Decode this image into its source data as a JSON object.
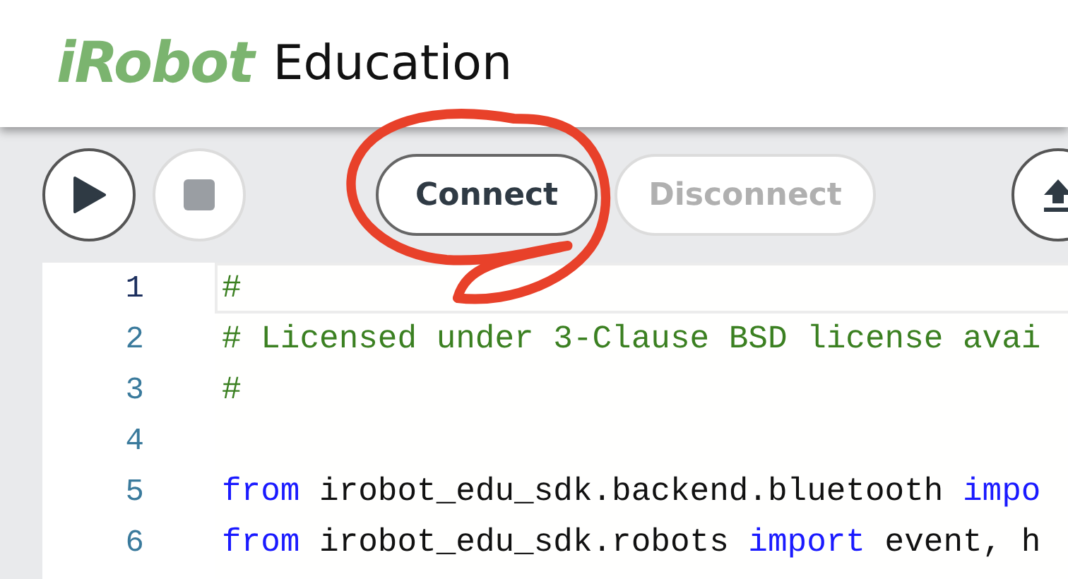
{
  "header": {
    "logo": "iRobot",
    "title": "Education"
  },
  "toolbar": [
    {
      "kind": "play",
      "disabled": false
    },
    {
      "kind": "stop",
      "disabled": true
    },
    {
      "kind": "text",
      "label": "Connect",
      "disabled": false
    },
    {
      "kind": "text",
      "label": "Disconnect",
      "disabled": true
    },
    {
      "kind": "upload",
      "disabled": false
    }
  ],
  "editor": {
    "lines": [
      {
        "number": "1",
        "active": true,
        "tokens": [
          {
            "kind": "comment",
            "text": "#"
          }
        ]
      },
      {
        "number": "2",
        "active": false,
        "tokens": [
          {
            "kind": "comment",
            "text": "# Licensed under 3-Clause BSD license avai"
          }
        ]
      },
      {
        "number": "3",
        "active": false,
        "tokens": [
          {
            "kind": "comment",
            "text": "#"
          }
        ]
      },
      {
        "number": "4",
        "active": false
      },
      {
        "number": "5",
        "active": false,
        "tokens": [
          {
            "kind": "keyword",
            "text": "from"
          },
          {
            "kind": "plain",
            "text": " irobot_edu_sdk.backend.bluetooth "
          },
          {
            "kind": "keyword",
            "text": "impo"
          }
        ]
      },
      {
        "number": "6",
        "active": false,
        "tokens": [
          {
            "kind": "keyword",
            "text": "from"
          },
          {
            "kind": "plain",
            "text": " irobot_edu_sdk.robots "
          },
          {
            "kind": "keyword",
            "text": "import"
          },
          {
            "kind": "plain",
            "text": " event, h"
          }
        ]
      }
    ]
  }
}
